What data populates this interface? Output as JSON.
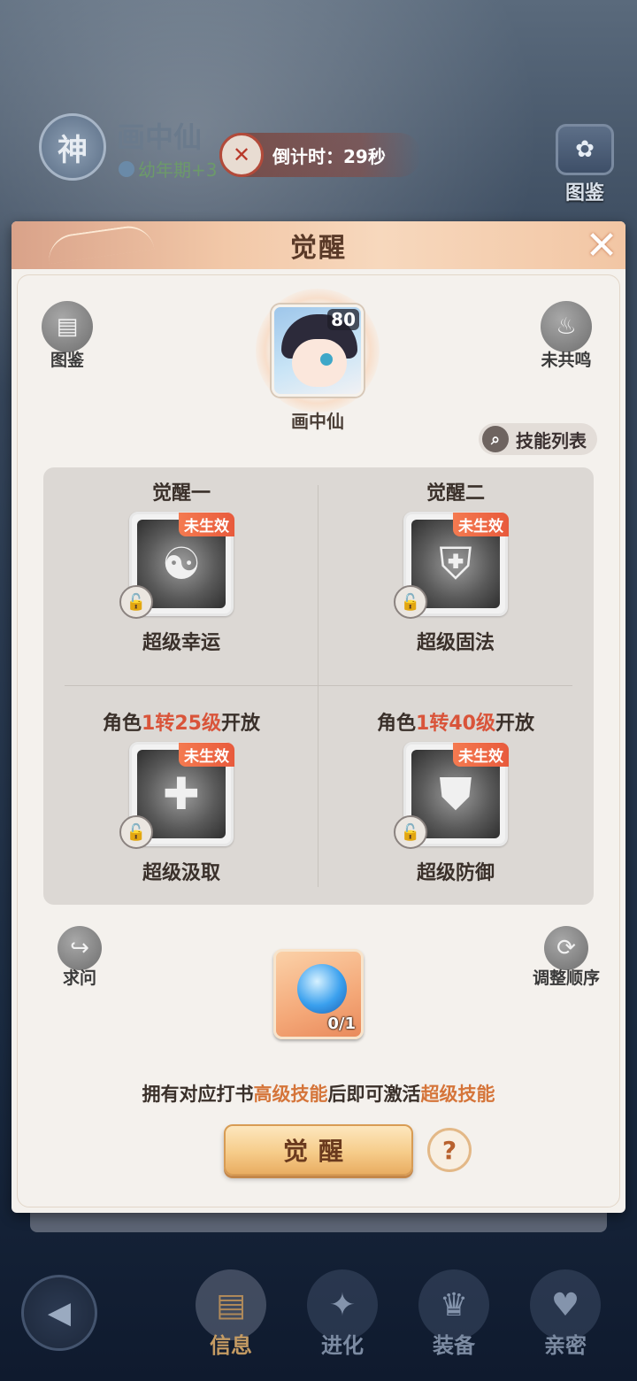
{
  "background": {
    "badge": "神",
    "pet_name": "画中仙",
    "pet_stage": "幼年期+3",
    "countdown": "倒计时：29秒",
    "tujian_label": "图鉴"
  },
  "modal": {
    "title": "觉醒",
    "close_symbol": "✕",
    "left_button_label": "图鉴",
    "right_button_label": "未共鸣",
    "hero": {
      "name": "画中仙",
      "level": "80"
    },
    "skill_list_label": "技能列表",
    "awakenings": [
      {
        "title": "觉醒一",
        "title_prefix": "",
        "title_hl": "",
        "title_suffix": "",
        "status": "未生效",
        "skill_name": "超级幸运",
        "icon": "koi-fish-icon"
      },
      {
        "title": "觉醒二",
        "title_prefix": "",
        "title_hl": "",
        "title_suffix": "",
        "status": "未生效",
        "skill_name": "超级固法",
        "icon": "flame-shield-icon"
      },
      {
        "title": "",
        "title_prefix": "角色",
        "title_hl": "1转25级",
        "title_suffix": "开放",
        "status": "未生效",
        "skill_name": "超级汲取",
        "icon": "heal-slash-icon"
      },
      {
        "title": "",
        "title_prefix": "角色",
        "title_hl": "1转40级",
        "title_suffix": "开放",
        "status": "未生效",
        "skill_name": "超级防御",
        "icon": "demon-shield-icon"
      }
    ],
    "ask_label": "求问",
    "reorder_label": "调整顺序",
    "item_count": "0/1",
    "hint": {
      "part1": "拥有对应打书",
      "hl1": "高级技能",
      "part2": "后即可激活",
      "hl2": "超级技能"
    },
    "awaken_button": "觉醒",
    "help_symbol": "?"
  },
  "bottom_nav": {
    "tabs": [
      {
        "label": "信息",
        "active": true
      },
      {
        "label": "进化",
        "active": false
      },
      {
        "label": "装备",
        "active": false
      },
      {
        "label": "亲密",
        "active": false
      }
    ]
  },
  "colors": {
    "accent": "#d9543a",
    "highlight": "#d5753a",
    "tag": "#e85a3c"
  }
}
